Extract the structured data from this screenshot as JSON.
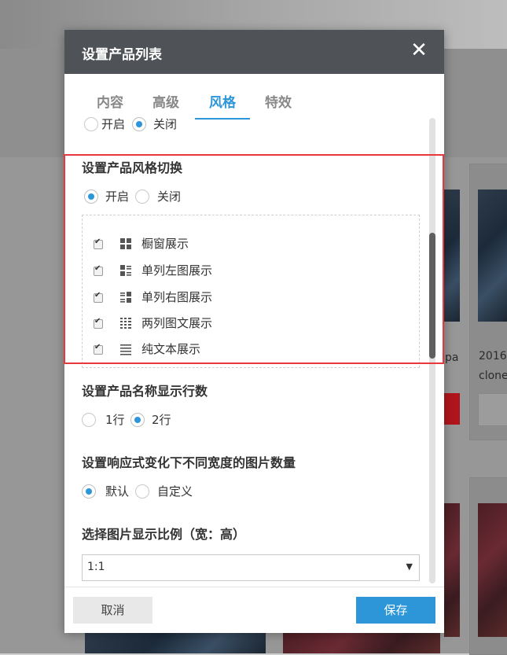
{
  "dialog": {
    "title": "设置产品列表",
    "close_icon": "close-icon"
  },
  "tabs": [
    {
      "label": "内容",
      "active": false
    },
    {
      "label": "高级",
      "active": false
    },
    {
      "label": "风格",
      "active": true
    },
    {
      "label": "特效",
      "active": false
    }
  ],
  "top_toggle": {
    "on_label": "开启",
    "off_label": "关闭",
    "selected": "off"
  },
  "style_switch": {
    "title": "设置产品风格切换",
    "on_label": "开启",
    "off_label": "关闭",
    "selected": "on",
    "options": [
      {
        "label": "橱窗展示",
        "checked": true,
        "icon": "grid-icon"
      },
      {
        "label": "单列左图展示",
        "checked": true,
        "icon": "list-left-image-icon"
      },
      {
        "label": "单列右图展示",
        "checked": true,
        "icon": "list-right-image-icon"
      },
      {
        "label": "两列图文展示",
        "checked": true,
        "icon": "two-column-icon"
      },
      {
        "label": "纯文本展示",
        "checked": true,
        "icon": "text-lines-icon"
      }
    ]
  },
  "name_lines": {
    "title": "设置产品名称显示行数",
    "opt1": "1行",
    "opt2": "2行",
    "selected": "2行"
  },
  "responsive": {
    "title": "设置响应式变化下不同宽度的图片数量",
    "opt1": "默认",
    "opt2": "自定义",
    "selected": "默认"
  },
  "ratio": {
    "title": "选择图片显示比例（宽：高）",
    "value": "1:1"
  },
  "footer": {
    "cancel_label": "取消",
    "save_label": "保存"
  },
  "background": {
    "card_text_1": "2016",
    "card_text_2": "clone",
    "card_text_3": "pa"
  },
  "colors": {
    "accent": "#2c96d8",
    "header": "#4f5257",
    "highlight": "#e8383d"
  }
}
